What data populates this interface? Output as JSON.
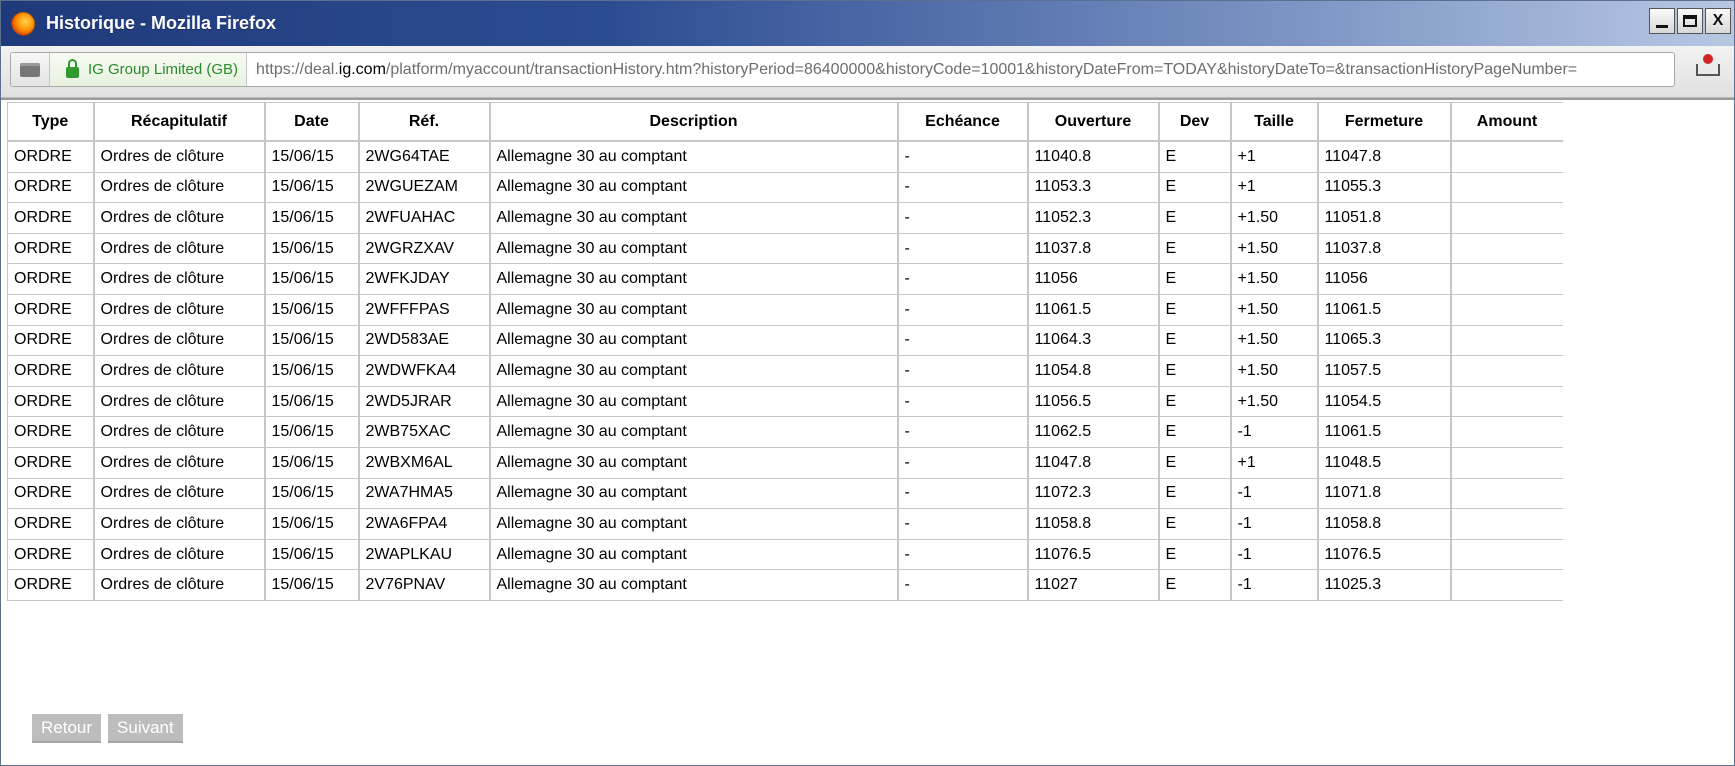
{
  "window": {
    "title": "Historique - Mozilla Firefox",
    "min_label": "",
    "max_label": "",
    "close_label": "X"
  },
  "navbar": {
    "identity": "IG Group Limited (GB)",
    "url_prefix": "https://deal.",
    "url_domain": "ig.com",
    "url_suffix": "/platform/myaccount/transactionHistory.htm?historyPeriod=86400000&historyCode=10001&historyDateFrom=TODAY&historyDateTo=&transactionHistoryPageNumber="
  },
  "table": {
    "headers": [
      "Type",
      "Récapitulatif",
      "Date",
      "Réf.",
      "Description",
      "Echéance",
      "Ouverture",
      "Dev",
      "Taille",
      "Fermeture",
      "Amount"
    ],
    "rows": [
      [
        "ORDRE",
        "Ordres de clôture",
        "15/06/15",
        "2WG64TAE",
        "Allemagne 30 au comptant",
        "-",
        "11040.8",
        "E",
        "+1",
        "11047.8",
        ""
      ],
      [
        "ORDRE",
        "Ordres de clôture",
        "15/06/15",
        "2WGUEZAM",
        "Allemagne 30 au comptant",
        "-",
        "11053.3",
        "E",
        "+1",
        "11055.3",
        ""
      ],
      [
        "ORDRE",
        "Ordres de clôture",
        "15/06/15",
        "2WFUAHAC",
        "Allemagne 30 au comptant",
        "-",
        "11052.3",
        "E",
        "+1.50",
        "11051.8",
        ""
      ],
      [
        "ORDRE",
        "Ordres de clôture",
        "15/06/15",
        "2WGRZXAV",
        "Allemagne 30 au comptant",
        "-",
        "11037.8",
        "E",
        "+1.50",
        "11037.8",
        ""
      ],
      [
        "ORDRE",
        "Ordres de clôture",
        "15/06/15",
        "2WFKJDAY",
        "Allemagne 30 au comptant",
        "-",
        "11056",
        "E",
        "+1.50",
        "11056",
        ""
      ],
      [
        "ORDRE",
        "Ordres de clôture",
        "15/06/15",
        "2WFFFPAS",
        "Allemagne 30 au comptant",
        "-",
        "11061.5",
        "E",
        "+1.50",
        "11061.5",
        ""
      ],
      [
        "ORDRE",
        "Ordres de clôture",
        "15/06/15",
        "2WD583AE",
        "Allemagne 30 au comptant",
        "-",
        "11064.3",
        "E",
        "+1.50",
        "11065.3",
        ""
      ],
      [
        "ORDRE",
        "Ordres de clôture",
        "15/06/15",
        "2WDWFKA4",
        "Allemagne 30 au comptant",
        "-",
        "11054.8",
        "E",
        "+1.50",
        "11057.5",
        ""
      ],
      [
        "ORDRE",
        "Ordres de clôture",
        "15/06/15",
        "2WD5JRAR",
        "Allemagne 30 au comptant",
        "-",
        "11056.5",
        "E",
        "+1.50",
        "11054.5",
        ""
      ],
      [
        "ORDRE",
        "Ordres de clôture",
        "15/06/15",
        "2WB75XAC",
        "Allemagne 30 au comptant",
        "-",
        "11062.5",
        "E",
        "-1",
        "11061.5",
        ""
      ],
      [
        "ORDRE",
        "Ordres de clôture",
        "15/06/15",
        "2WBXM6AL",
        "Allemagne 30 au comptant",
        "-",
        "11047.8",
        "E",
        "+1",
        "11048.5",
        ""
      ],
      [
        "ORDRE",
        "Ordres de clôture",
        "15/06/15",
        "2WA7HMA5",
        "Allemagne 30 au comptant",
        "-",
        "11072.3",
        "E",
        "-1",
        "11071.8",
        ""
      ],
      [
        "ORDRE",
        "Ordres de clôture",
        "15/06/15",
        "2WA6FPA4",
        "Allemagne 30 au comptant",
        "-",
        "11058.8",
        "E",
        "-1",
        "11058.8",
        ""
      ],
      [
        "ORDRE",
        "Ordres de clôture",
        "15/06/15",
        "2WAPLKAU",
        "Allemagne 30 au comptant",
        "-",
        "11076.5",
        "E",
        "-1",
        "11076.5",
        ""
      ],
      [
        "ORDRE",
        "Ordres de clôture",
        "15/06/15",
        "2V76PNAV",
        "Allemagne 30 au comptant",
        "-",
        "11027",
        "E",
        "-1",
        "11025.3",
        ""
      ]
    ]
  },
  "pager": {
    "back_label": "Retour",
    "next_label": "Suivant"
  },
  "icons": {
    "browser": "firefox-icon",
    "lock": "lock-icon",
    "site": "site-icon",
    "addon": "notification-icon"
  }
}
